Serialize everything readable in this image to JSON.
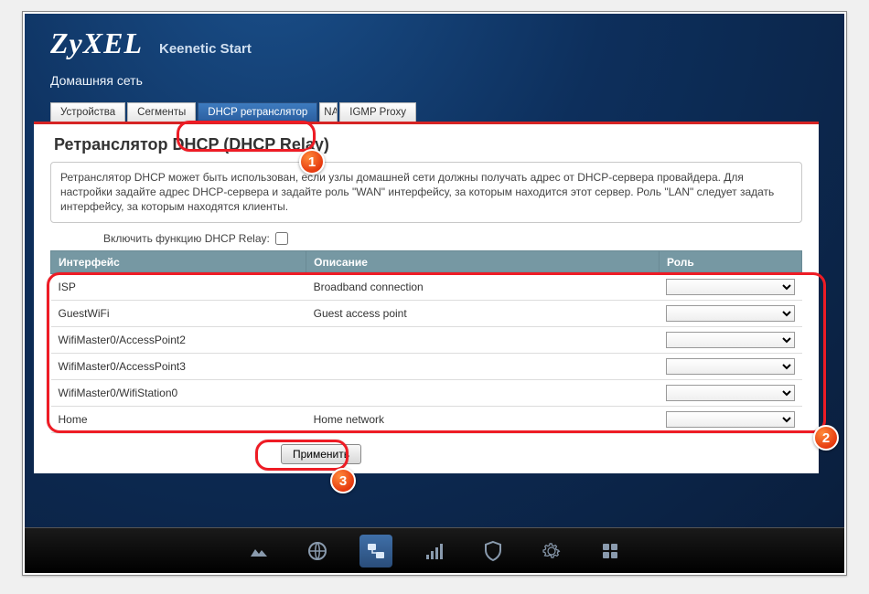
{
  "brand": {
    "logo": "ZyXEL",
    "model": "Keenetic Start"
  },
  "section": "Домашняя сеть",
  "tabs": [
    {
      "label": "Устройства",
      "active": false
    },
    {
      "label": "Сегменты",
      "active": false
    },
    {
      "label": "DHCP ретранслятор",
      "active": true
    },
    {
      "label": "NAT",
      "active": false
    },
    {
      "label": "IGMP Proxy",
      "active": false
    }
  ],
  "page": {
    "heading": "Ретранслятор DHCP (DHCP Relay)",
    "description": "Ретранслятор DHCP может быть использован, если узлы домашней сети должны получать адрес от DHCP-сервера провайдера. Для настройки задайте адрес DHCP-сервера и задайте роль \"WAN\" интерфейсу, за которым находится этот сервер. Роль \"LAN\" следует задать интерфейсу, за которым находятся клиенты.",
    "enable_label": "Включить функцию DHCP Relay:",
    "enable_checked": false,
    "table": {
      "headers": {
        "iface": "Интерфейс",
        "desc": "Описание",
        "role": "Роль"
      },
      "rows": [
        {
          "iface": "ISP",
          "desc": "Broadband connection",
          "role": ""
        },
        {
          "iface": "GuestWiFi",
          "desc": "Guest access point",
          "role": ""
        },
        {
          "iface": "WifiMaster0/AccessPoint2",
          "desc": "",
          "role": ""
        },
        {
          "iface": "WifiMaster0/AccessPoint3",
          "desc": "",
          "role": ""
        },
        {
          "iface": "WifiMaster0/WifiStation0",
          "desc": "",
          "role": ""
        },
        {
          "iface": "Home",
          "desc": "Home network",
          "role": ""
        }
      ]
    },
    "apply_label": "Применить"
  },
  "annotations": {
    "b1": "1",
    "b2": "2",
    "b3": "3"
  }
}
